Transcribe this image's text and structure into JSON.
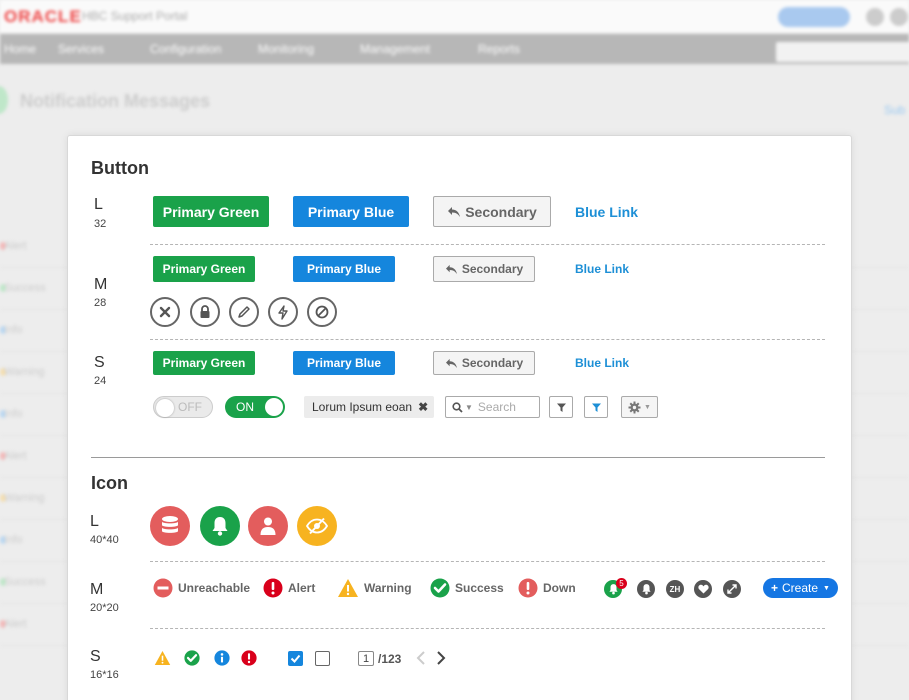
{
  "background": {
    "logo": "ORACLE",
    "portal": "HBC Support Portal",
    "nav": [
      "Home",
      "Services",
      "Configuration",
      "Monitoring",
      "Management",
      "Reports"
    ],
    "search_placeholder": "Search",
    "page_title": "Notification Messages",
    "rows": [
      "Alert",
      "Success",
      "Info",
      "Warning",
      "Info",
      "Alert",
      "Warning",
      "Info",
      "Success",
      "Alert",
      "Alert"
    ]
  },
  "button_section": {
    "title": "Button",
    "large": {
      "letter": "L",
      "size": "32"
    },
    "medium": {
      "letter": "M",
      "size": "28"
    },
    "small": {
      "letter": "S",
      "size": "24"
    },
    "primary_green": "Primary Green",
    "primary_blue": "Primary Blue",
    "secondary": "Secondary",
    "blue_link": "Blue Link",
    "toggle_off": "OFF",
    "toggle_on": "ON",
    "tag": "Lorum Ipsum eoan",
    "search_placeholder": "Search"
  },
  "icon_section": {
    "title": "Icon",
    "large": {
      "letter": "L",
      "size": "40*40"
    },
    "medium": {
      "letter": "M",
      "size": "20*20"
    },
    "small": {
      "letter": "S",
      "size": "16*16"
    },
    "statuses": {
      "unreachable": "Unreachable",
      "alert": "Alert",
      "warning": "Warning",
      "success": "Success",
      "down": "Down"
    },
    "notification_count": "5",
    "language": "ZH",
    "create": "Create",
    "page_current": "1",
    "page_total": "/123"
  },
  "colors": {
    "green": "#1aa24a",
    "blue": "#1586dd",
    "red": "#e35d5d",
    "orange": "#f7b320",
    "link": "#1d8fd6"
  }
}
